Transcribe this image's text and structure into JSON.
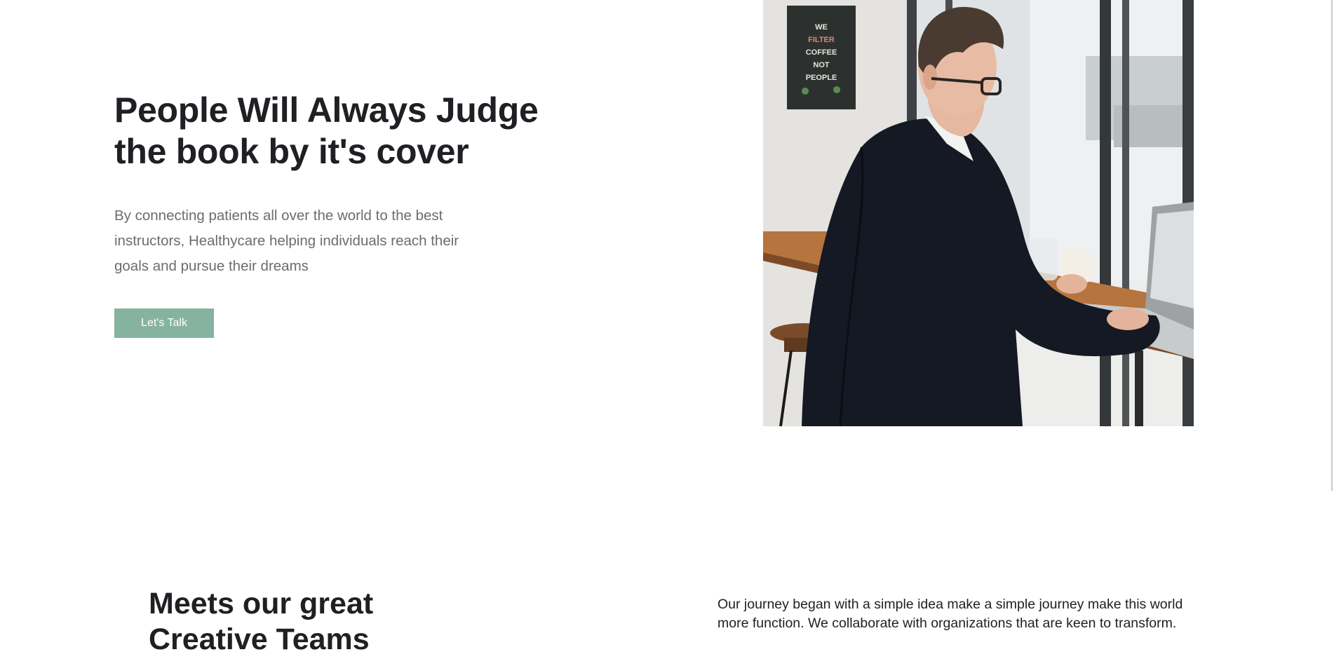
{
  "hero": {
    "title_line1": "People Will Always Judge",
    "title_line2": "the book by it's cover",
    "description": "By connecting patients all over the world to the best instructors, Healthycare helping individuals reach their goals and pursue their dreams",
    "cta_label": "Let's Talk",
    "poster_text": "WE FILTER COFFEE NOT PEOPLE"
  },
  "teams": {
    "title_line1": "Meets our great",
    "title_line2": "Creative Teams",
    "description": "Our journey began with a simple idea make a simple journey make this world more function. We collaborate with organizations that are keen to transform."
  },
  "colors": {
    "accent": "#86b39f",
    "heading": "#1f1f24",
    "body_text": "#6c6c72"
  }
}
